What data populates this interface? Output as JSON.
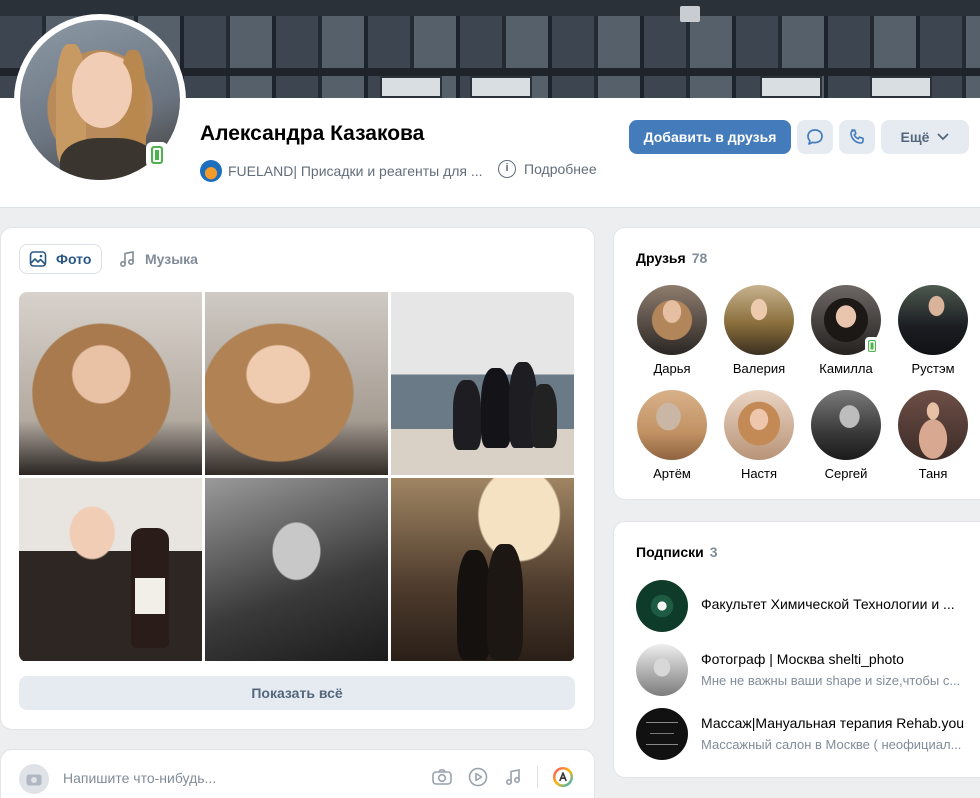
{
  "profile": {
    "name": "Александра Казакова",
    "status": "FUELAND| Присадки и реагенты для ...",
    "more_info": "Подробнее",
    "add_friend": "Добавить в друзья",
    "more_button": "Ещё"
  },
  "photos": {
    "tabs": [
      {
        "label": "Фото",
        "icon": "image-icon",
        "active": true
      },
      {
        "label": "Музыка",
        "icon": "music-note-icon",
        "active": false
      }
    ],
    "show_all": "Показать всё"
  },
  "post_box": {
    "placeholder": "Напишите что-нибудь..."
  },
  "friends": {
    "title": "Друзья",
    "count": "78",
    "items": [
      {
        "name": "Дарья"
      },
      {
        "name": "Валерия"
      },
      {
        "name": "Камилла",
        "online_mobile": true
      },
      {
        "name": "Рустэм"
      },
      {
        "name": "Артём"
      },
      {
        "name": "Настя"
      },
      {
        "name": "Сергей"
      },
      {
        "name": "Таня"
      }
    ]
  },
  "subscriptions": {
    "title": "Подписки",
    "count": "3",
    "items": [
      {
        "name": "Факультет Химической Технологии и ...",
        "desc": ""
      },
      {
        "name": "Фотограф | Москва shelti_photo",
        "desc": "Мне не важны ваши shape и size,чтобы с..."
      },
      {
        "name": "Массаж|Мануальная терапия Rehab.you",
        "desc": "Массажный салон в Москве ( неофициал..."
      }
    ]
  },
  "colors": {
    "primary_button": "#447bba",
    "secondary_button": "#e5ebf1",
    "online": "#4bb34b",
    "link": "#2a5885",
    "muted": "#818c99"
  }
}
